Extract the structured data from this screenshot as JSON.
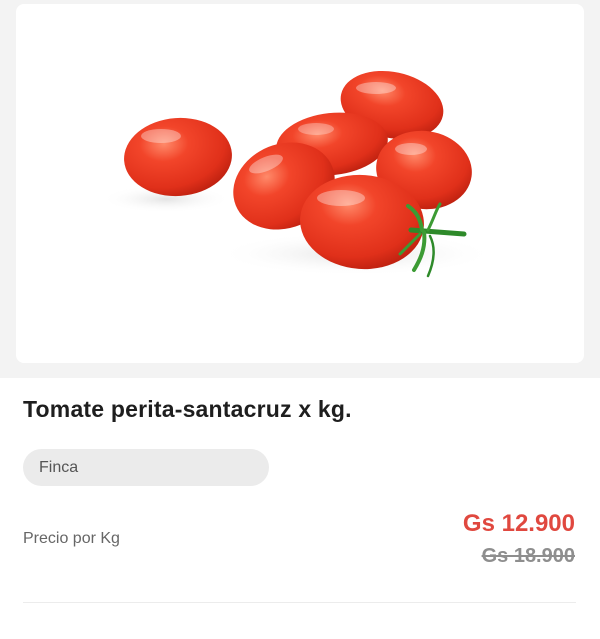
{
  "product": {
    "title": "Tomate perita-santacruz x kg.",
    "image_subject": "tomatoes-image",
    "vendor": "Finca",
    "price_label": "Precio por Kg",
    "price_current": "Gs 12.900",
    "price_old": "Gs 18.900"
  },
  "colors": {
    "price_current": "#e0483f",
    "price_old": "#8e8e8e",
    "chip_background": "#ebebeb",
    "image_area_background": "#f3f3f3"
  }
}
